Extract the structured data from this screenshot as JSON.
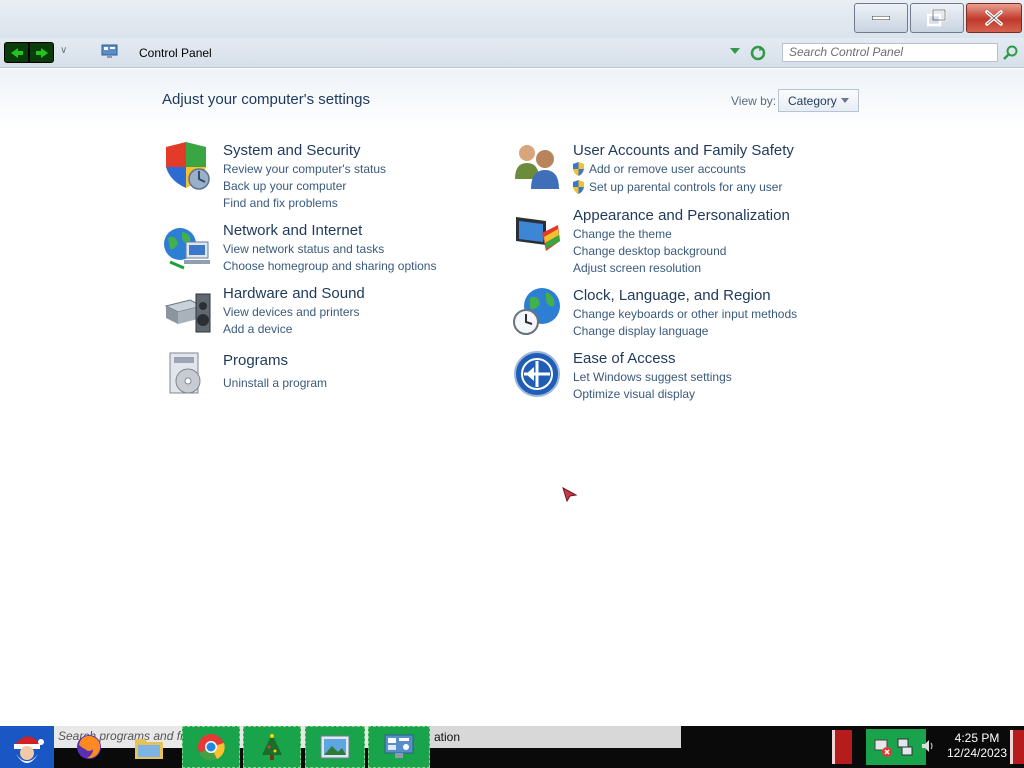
{
  "window": {
    "breadcrumb": "Control Panel",
    "search_placeholder": "Search Control Panel"
  },
  "content": {
    "title": "Adjust your computer's settings",
    "view_by_label": "View by:",
    "view_by_value": "Category"
  },
  "categories": [
    {
      "name": "System and Security",
      "icon": "shield-icon",
      "links": [
        "Review your computer's status",
        "Back up your computer",
        "Find and fix problems"
      ]
    },
    {
      "name": "Network and Internet",
      "icon": "globe-network-icon",
      "links": [
        "View network status and tasks",
        "Choose homegroup and sharing options"
      ]
    },
    {
      "name": "Hardware and Sound",
      "icon": "printer-speaker-icon",
      "links": [
        "View devices and printers",
        "Add a device"
      ]
    },
    {
      "name": "Programs",
      "icon": "programs-icon",
      "links": [
        "Uninstall a program"
      ]
    },
    {
      "name": "User Accounts and Family Safety",
      "icon": "users-icon",
      "links": [
        "Add or remove user accounts",
        "Set up parental controls for any user"
      ]
    },
    {
      "name": "Appearance and Personalization",
      "icon": "monitor-paint-icon",
      "links": [
        "Change the theme",
        "Change desktop background",
        "Adjust screen resolution"
      ]
    },
    {
      "name": "Clock, Language, and Region",
      "icon": "clock-globe-icon",
      "links": [
        "Change keyboards or other input methods",
        "Change display language"
      ]
    },
    {
      "name": "Ease of Access",
      "icon": "ease-of-access-icon",
      "links": [
        "Let Windows suggest settings",
        "Optimize visual display"
      ]
    }
  ],
  "taskbar": {
    "search_text": "Search programs and fi",
    "tail_text": "ation",
    "clock_time": "4:25 PM",
    "clock_date": "12/24/2023"
  }
}
